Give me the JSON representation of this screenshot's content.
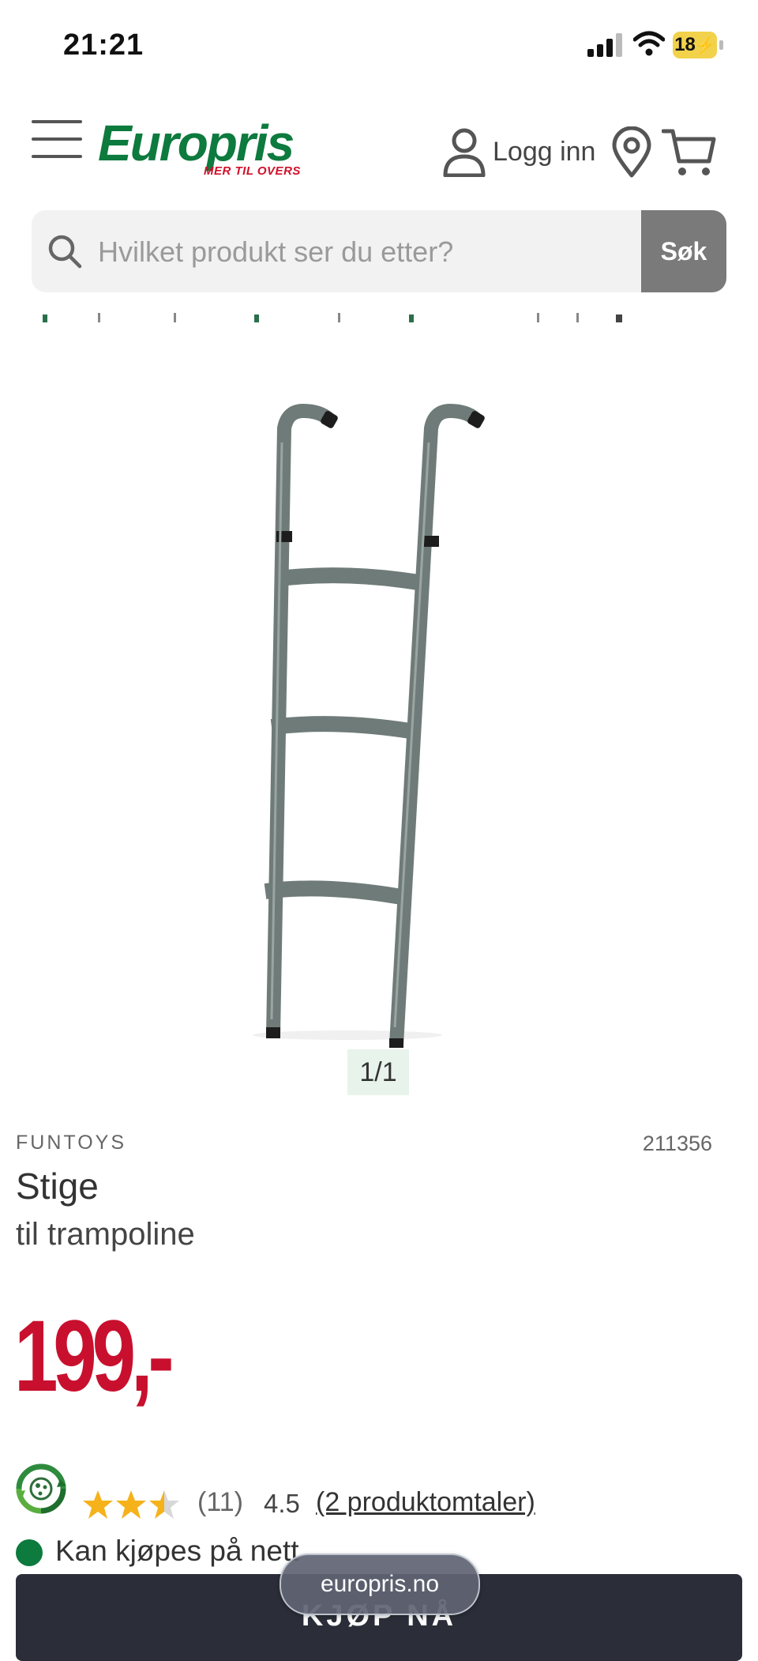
{
  "status_bar": {
    "time": "21:21",
    "battery": "18"
  },
  "header": {
    "logo_text": "Europris",
    "logo_tagline": "MER TIL OVERS",
    "login_label": "Logg inn"
  },
  "search": {
    "placeholder": "Hvilket produkt ser du etter?",
    "button_label": "Søk"
  },
  "gallery": {
    "counter": "1/1"
  },
  "product": {
    "brand": "FUNTOYS",
    "sku": "211356",
    "title": "Stige",
    "subtitle": "til trampoline",
    "price": "199,-",
    "rating": {
      "stars_filled": 2.5,
      "stars_total": 3,
      "count": "(11)",
      "value": "4.5",
      "reviews_link": "(2 produktomtaler)"
    },
    "availability": "Kan kjøpes på nett",
    "buy_button": "KJØP NÅ"
  },
  "browser": {
    "url": "europris.no"
  },
  "colors": {
    "brand_green": "#0d7a3e",
    "price_red": "#c8102e",
    "star_gold": "#f5b21b",
    "buy_button_bg": "#2b2e38"
  }
}
